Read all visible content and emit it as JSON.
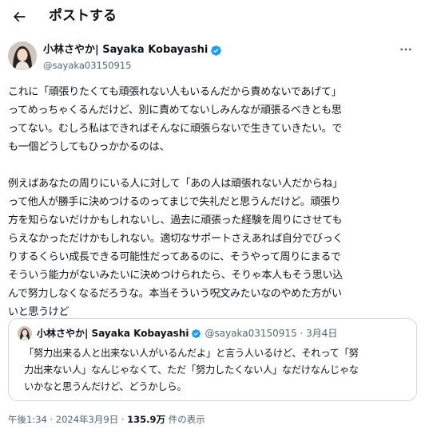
{
  "header": {
    "title": "ポストする"
  },
  "author": {
    "name": "小林さやか| Sayaka Kobayashi",
    "handle": "@sayaka03150915"
  },
  "post": {
    "paragraph1": [
      "これに「頑張りたくても頑張れない人もいるんだから責めないであげて」",
      "ってめっちゃくるんだけど、別に責めてないしみんなが頑張るべきとも思",
      "ってない。むしろ私はできればそんなに頑張らないで生きていきたい。で",
      "も一個どうしてもひっかかるのは、"
    ],
    "paragraph2": [
      "例えばあなたの周りにいる人に対して「あの人は頑張れない人だからね」",
      "って他人が勝手に決めつけるのってまじで失礼だと思うんだけど。頑張り",
      "方を知らないだけかもしれないし、過去に頑張った経験を周りにさせても",
      "らえなかっただけかもしれない。適切なサポートさえあれば自分でびっく",
      "りするくらい成長できる可能性だってあるのに、そうやって周りにまるで",
      "そういう能力がないみたいに決めつけられたら、そりゃ本人もそう思い込",
      "んで努力しなくなるだろうな。本当そういう呪文みたいなのやめた方がい",
      "いと思うけど"
    ]
  },
  "quote": {
    "name": "小林さやか| Sayaka Kobayashi",
    "meta": "@sayaka03150915 · 3月4日",
    "lines": [
      "「努力出来る人と出来ない人がいるんだよ」と言う人いるけど、それって「努",
      "力出来ない人」なんじゃなくて、ただ「努力したくない人」なだけなんじゃな",
      "いかなと思うんだけど、どうかしら。"
    ]
  },
  "footer": {
    "time": "午後1:34 · 2024年3月9日 · ",
    "views": "135.9万",
    "views_suffix": " 件の表示"
  },
  "icons": {
    "back": "arrow-left-icon",
    "verified": "verified-badge-icon",
    "more": "more-horizontal-icon"
  },
  "colors": {
    "verified": "#1d9bf0",
    "secondary_text": "#536471",
    "border": "#cfd9de"
  }
}
